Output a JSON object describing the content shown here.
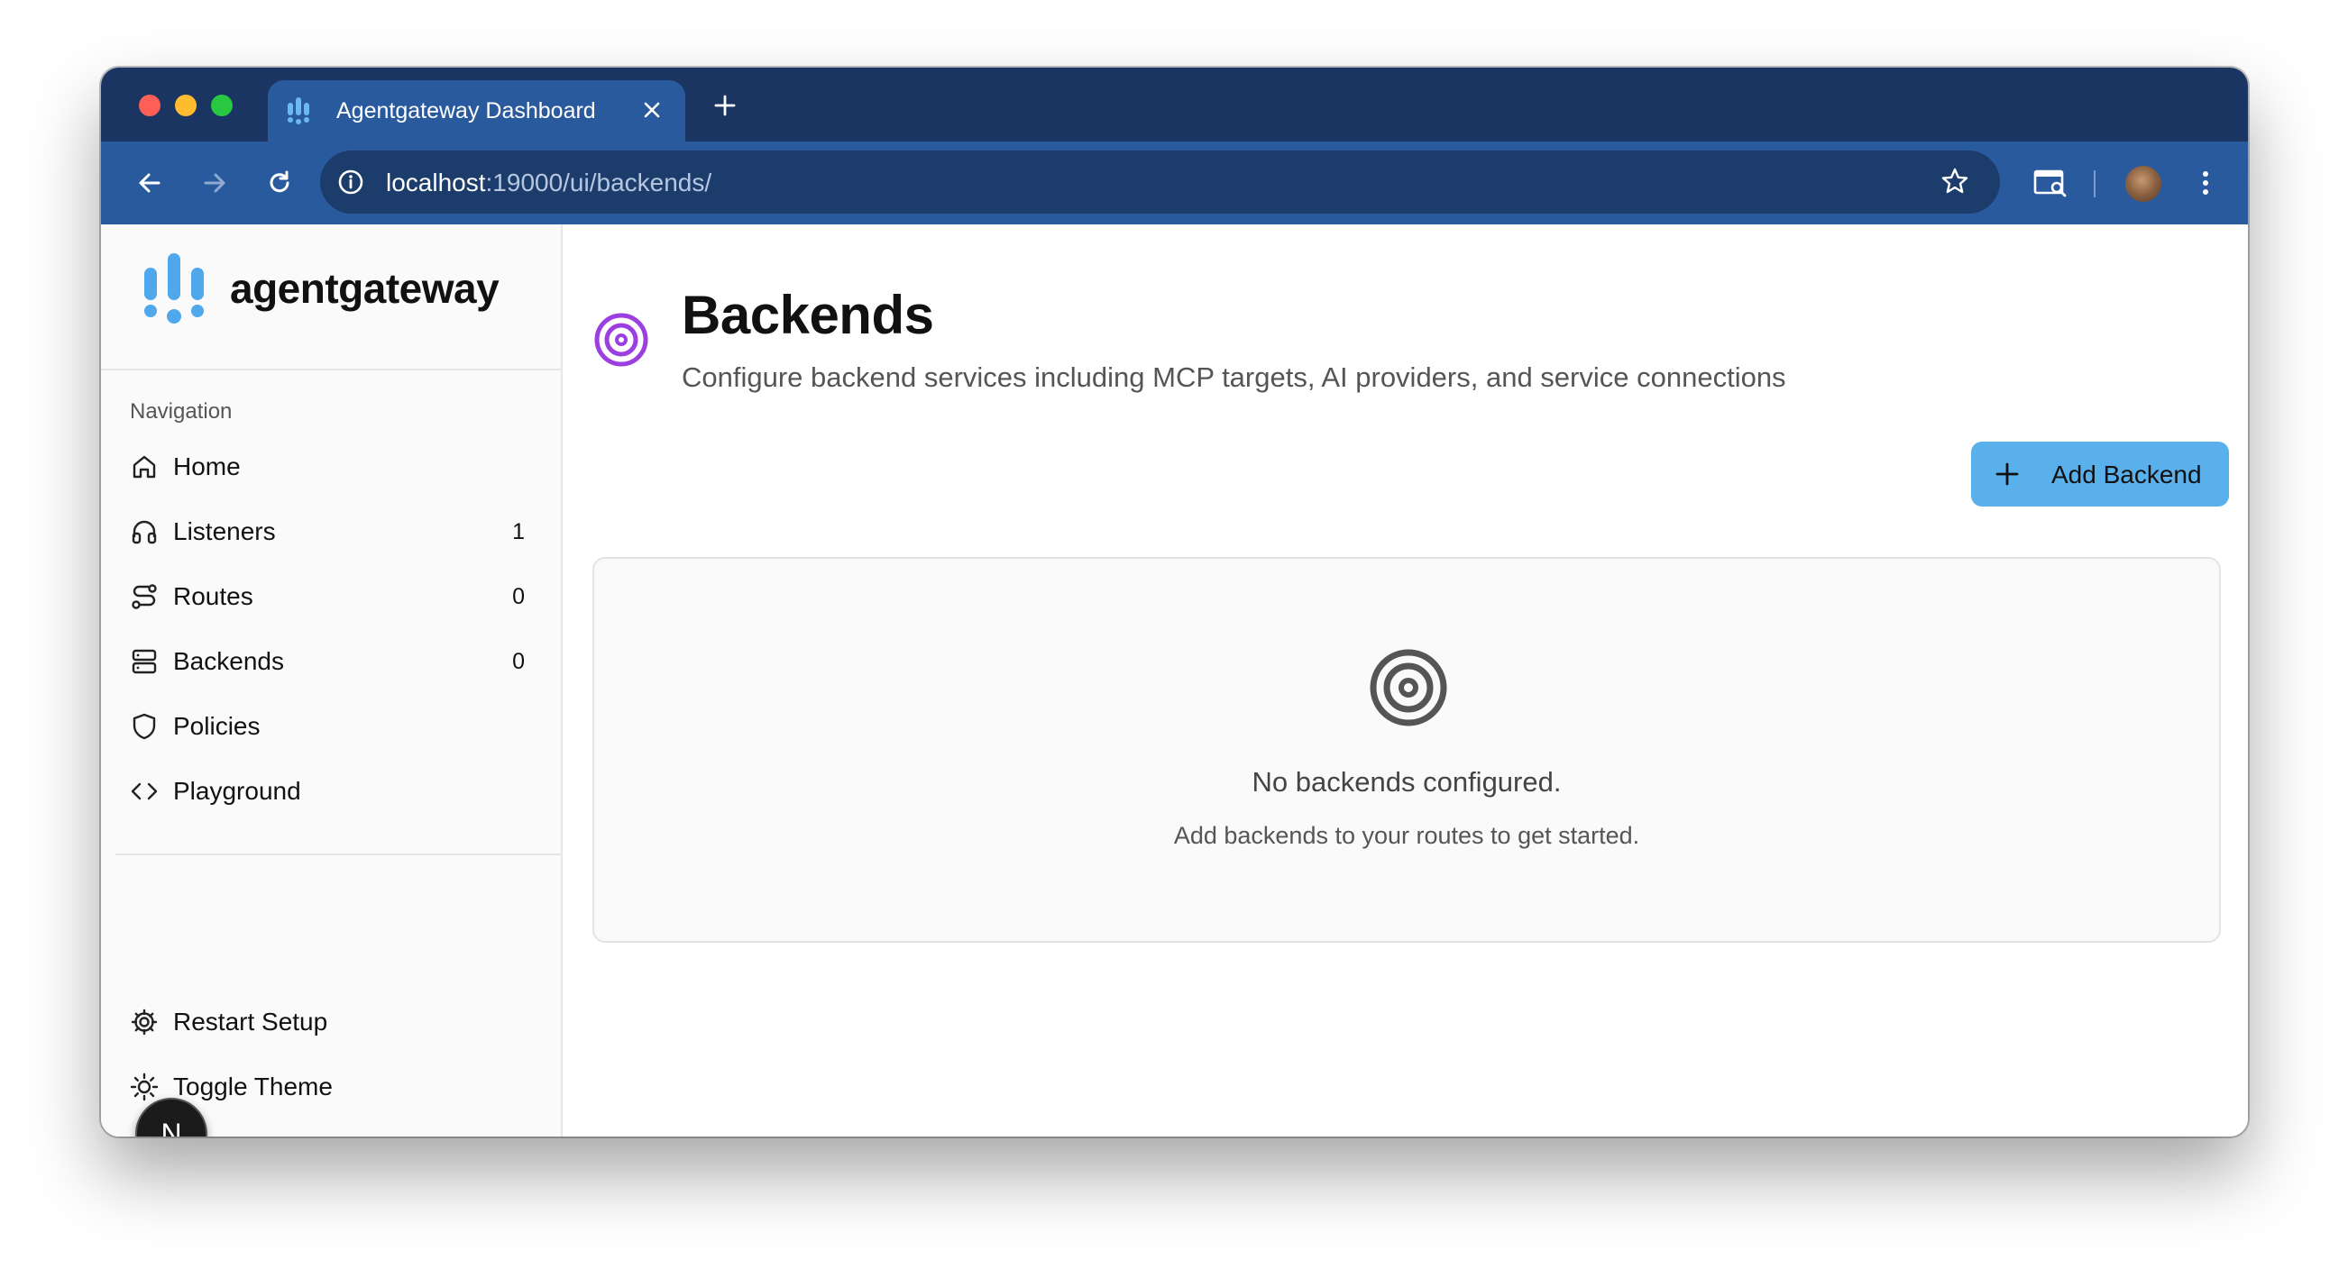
{
  "browser": {
    "tab_title": "Agentgateway Dashboard",
    "url_host": "localhost",
    "url_rest": ":19000/ui/backends/"
  },
  "icons": {
    "back": "arrow-left-icon",
    "forward": "arrow-right-icon",
    "reload": "reload-icon",
    "site_info": "info-icon",
    "bookmark": "star-icon",
    "cast": "cast-search-icon",
    "menu": "kebab-menu-icon"
  },
  "colors": {
    "tabbar": "#1b3563",
    "toolbar": "#2a5a9e",
    "accent": "#5ab0ea",
    "title_icon": "#9b3fe0",
    "logo": "#4fa8ec"
  },
  "sidebar": {
    "brand": "agentgateway",
    "nav_heading": "Navigation",
    "items": [
      {
        "label": "Home",
        "count": "",
        "icon": "home-icon"
      },
      {
        "label": "Listeners",
        "count": "1",
        "icon": "headphones-icon"
      },
      {
        "label": "Routes",
        "count": "0",
        "icon": "route-icon"
      },
      {
        "label": "Backends",
        "count": "0",
        "icon": "server-icon"
      },
      {
        "label": "Policies",
        "count": "",
        "icon": "shield-icon"
      },
      {
        "label": "Playground",
        "count": "",
        "icon": "code-icon"
      }
    ],
    "footer_items": [
      {
        "label": "Restart Setup",
        "icon": "gear-icon"
      },
      {
        "label": "Toggle Theme",
        "icon": "sun-icon"
      }
    ],
    "dev_badge": "N"
  },
  "main": {
    "title": "Backends",
    "subtitle": "Configure backend services including MCP targets, AI providers, and service connections",
    "add_button": "Add Backend",
    "empty_title": "No backends configured.",
    "empty_text": "Add backends to your routes to get started."
  }
}
